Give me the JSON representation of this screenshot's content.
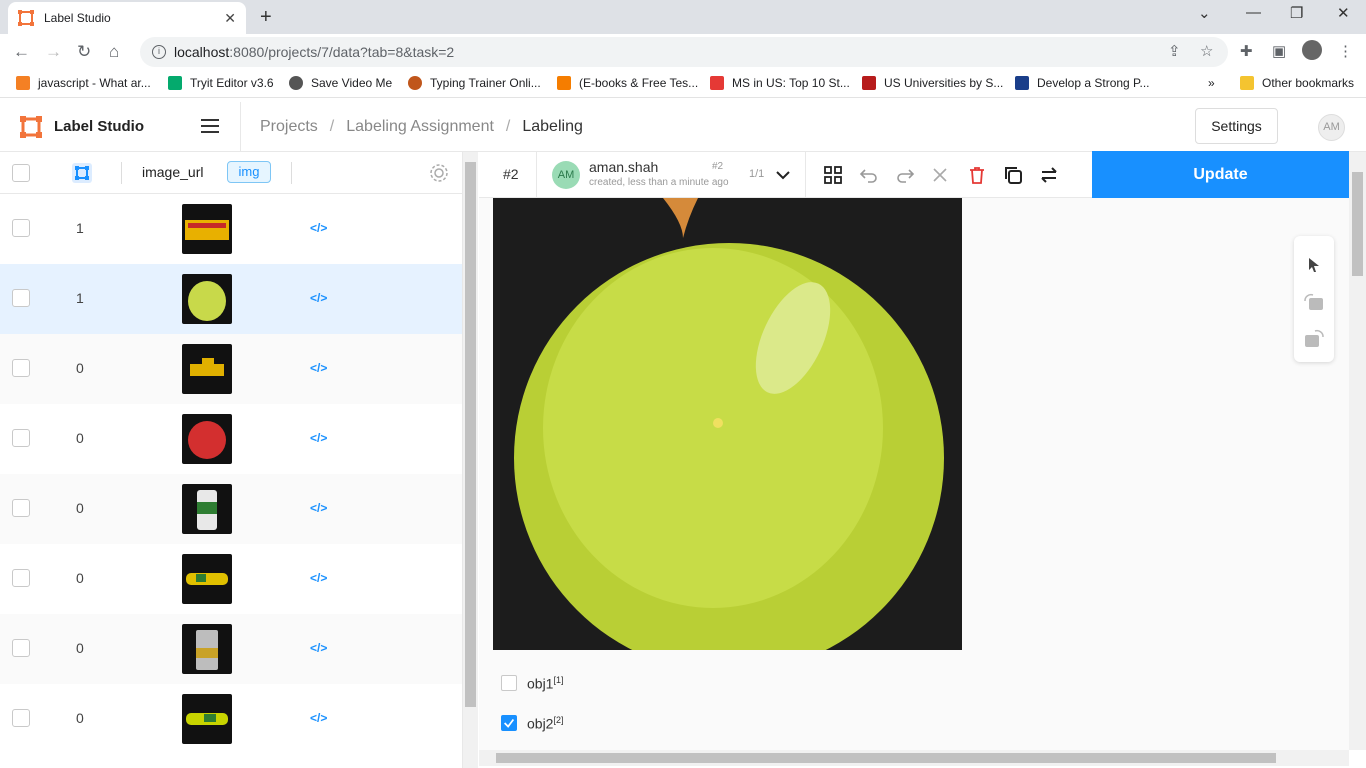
{
  "browser": {
    "tab_title": "Label Studio",
    "url_host": "localhost",
    "url_path": ":8080/projects/7/data?tab=8&task=2",
    "bookmarks": [
      {
        "label": "javascript - What ar...",
        "icon": "stackoverflow-icon",
        "color": "#f48024"
      },
      {
        "label": "Tryit Editor v3.6",
        "icon": "w3schools-icon",
        "color": "#04aa6d"
      },
      {
        "label": "Save Video Me",
        "icon": "globe-icon",
        "color": "#555555"
      },
      {
        "label": "Typing Trainer Onli...",
        "icon": "typing-icon",
        "color": "#c0561b"
      },
      {
        "label": "(E-books & Free Tes...",
        "icon": "blogger-icon",
        "color": "#f57d00"
      },
      {
        "label": "MS in US: Top 10 St...",
        "icon": "g-icon",
        "color": "#e53935"
      },
      {
        "label": "US Universities by S...",
        "icon": "g-red-icon",
        "color": "#b71c1c"
      },
      {
        "label": "Develop a Strong P...",
        "icon": "flag-icon",
        "color": "#1a3e8a"
      }
    ],
    "more_bookmarks": "»",
    "other_bookmarks": "Other bookmarks"
  },
  "app": {
    "brand": "Label Studio",
    "breadcrumbs": [
      "Projects",
      "Labeling Assignment",
      "Labeling"
    ],
    "breadcrumb_sep": "/",
    "settings_label": "Settings",
    "avatar_initials": "AM"
  },
  "table": {
    "column_name": "image_url",
    "column_tag": "img",
    "code_glyph": "</>",
    "rows": [
      {
        "num": "1",
        "thumb": "box"
      },
      {
        "num": "1",
        "thumb": "onion"
      },
      {
        "num": "0",
        "thumb": "toy"
      },
      {
        "num": "0",
        "thumb": "tomato"
      },
      {
        "num": "0",
        "thumb": "bottle"
      },
      {
        "num": "0",
        "thumb": "car"
      },
      {
        "num": "0",
        "thumb": "can"
      },
      {
        "num": "0",
        "thumb": "car2"
      }
    ]
  },
  "annotation": {
    "task_label": "#2",
    "user_initials": "AM",
    "user_name": "aman.shah",
    "annotation_index": "#2",
    "created": "created, less than a minute ago",
    "count": "1/1",
    "update_label": "Update",
    "choices": [
      {
        "label": "obj1",
        "hotkey": "[1]",
        "checked": false
      },
      {
        "label": "obj2",
        "hotkey": "[2]",
        "checked": true
      }
    ]
  },
  "colors": {
    "accent": "#1890ff",
    "selected_row": "#e6f2ff"
  }
}
